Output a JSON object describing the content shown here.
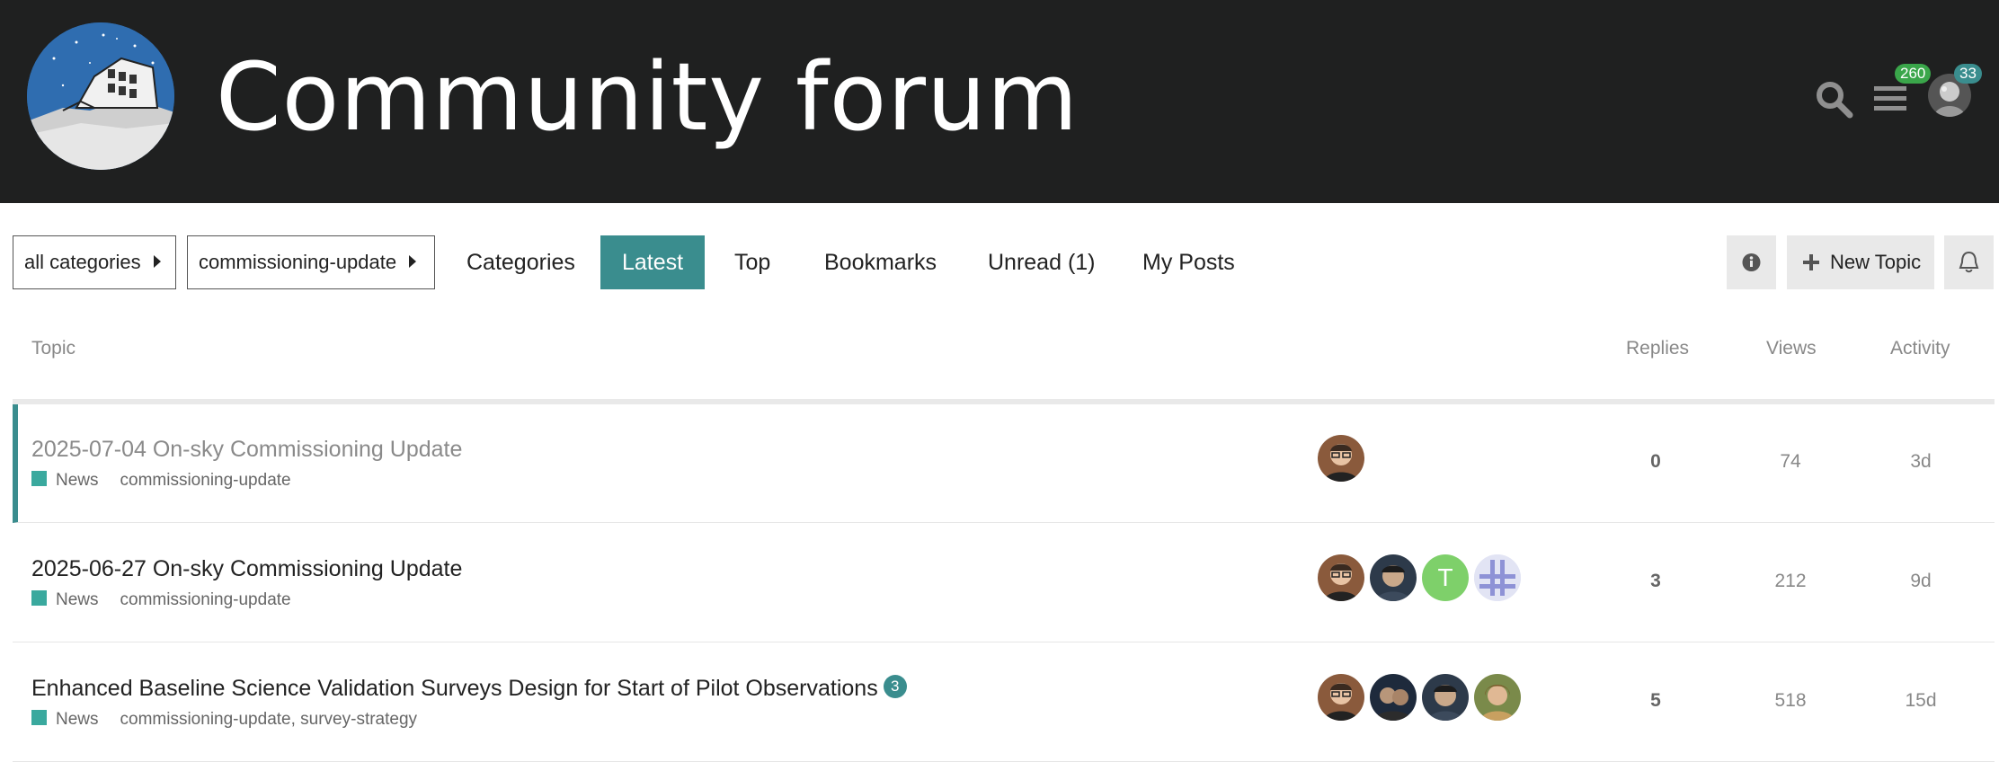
{
  "header": {
    "site_title": "Community forum",
    "notifications_count": "260",
    "messages_count": "33"
  },
  "nav": {
    "category_dropdown": "all categories",
    "tag_dropdown": "commissioning-update",
    "links": [
      "Categories",
      "Latest",
      "Top",
      "Bookmarks",
      "Unread (1)",
      "My Posts"
    ],
    "active_link": "Latest",
    "new_topic_label": "New Topic"
  },
  "table": {
    "columns": {
      "topic": "Topic",
      "replies": "Replies",
      "views": "Views",
      "activity": "Activity"
    },
    "rows": [
      {
        "title": "2025-07-04 On-sky Commissioning Update",
        "category": "News",
        "tags": "commissioning-update",
        "unread_count": "",
        "replies": "0",
        "views": "74",
        "activity": "3d"
      },
      {
        "title": "2025-06-27 On-sky Commissioning Update",
        "category": "News",
        "tags": "commissioning-update",
        "unread_count": "",
        "replies": "3",
        "views": "212",
        "activity": "9d",
        "letter_avatar": "T"
      },
      {
        "title": "Enhanced Baseline Science Validation Surveys Design for Start of Pilot Observations",
        "category": "News",
        "tags": "commissioning-update, survey-strategy",
        "unread_count": "3",
        "replies": "5",
        "views": "518",
        "activity": "15d"
      }
    ]
  },
  "colors": {
    "header_bg": "#1f2020",
    "accent": "#3a8d8e",
    "category_news": "#3aa99e",
    "badge_green": "#3aa64a"
  }
}
